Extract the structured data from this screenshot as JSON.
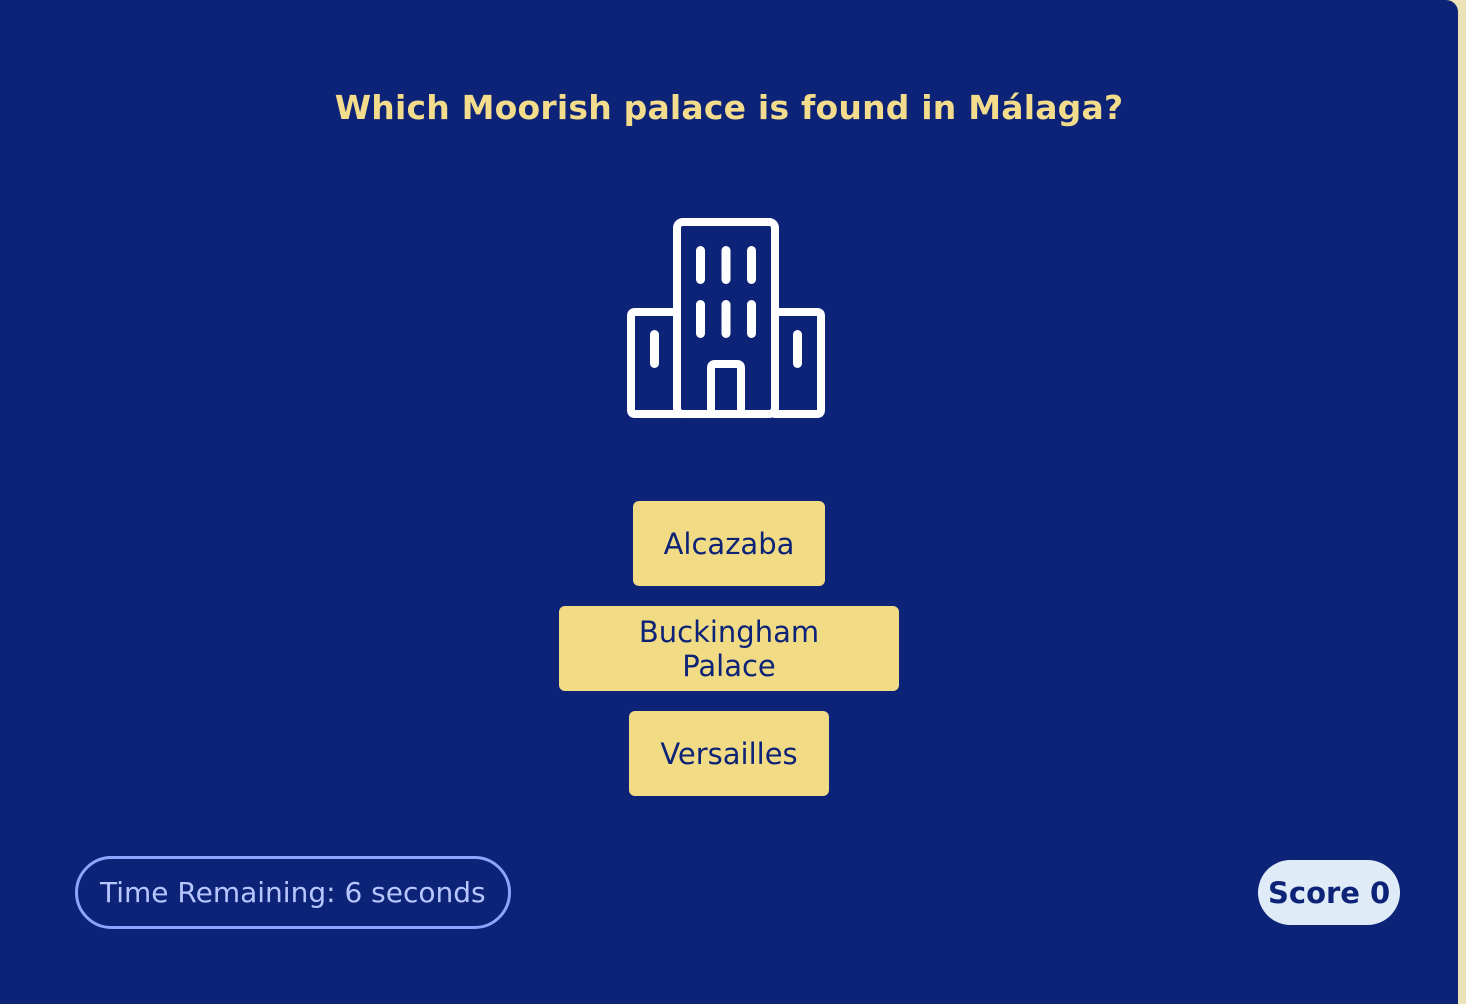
{
  "quiz": {
    "question": "Which Moorish palace is found in Málaga?",
    "icon": "building-icon",
    "answers": [
      {
        "label": "Alcazaba"
      },
      {
        "label": "Buckingham Palace"
      },
      {
        "label": "Versailles"
      }
    ]
  },
  "status": {
    "timer_text": "Time Remaining: 6 seconds",
    "score_label": "Score",
    "score_value": "0"
  },
  "colors": {
    "background": "#0c2377",
    "question_text": "#f3dc8b",
    "answer_button": "#f2db85",
    "timer_border": "#8ea4ff",
    "score_badge": "#dfecf8"
  }
}
